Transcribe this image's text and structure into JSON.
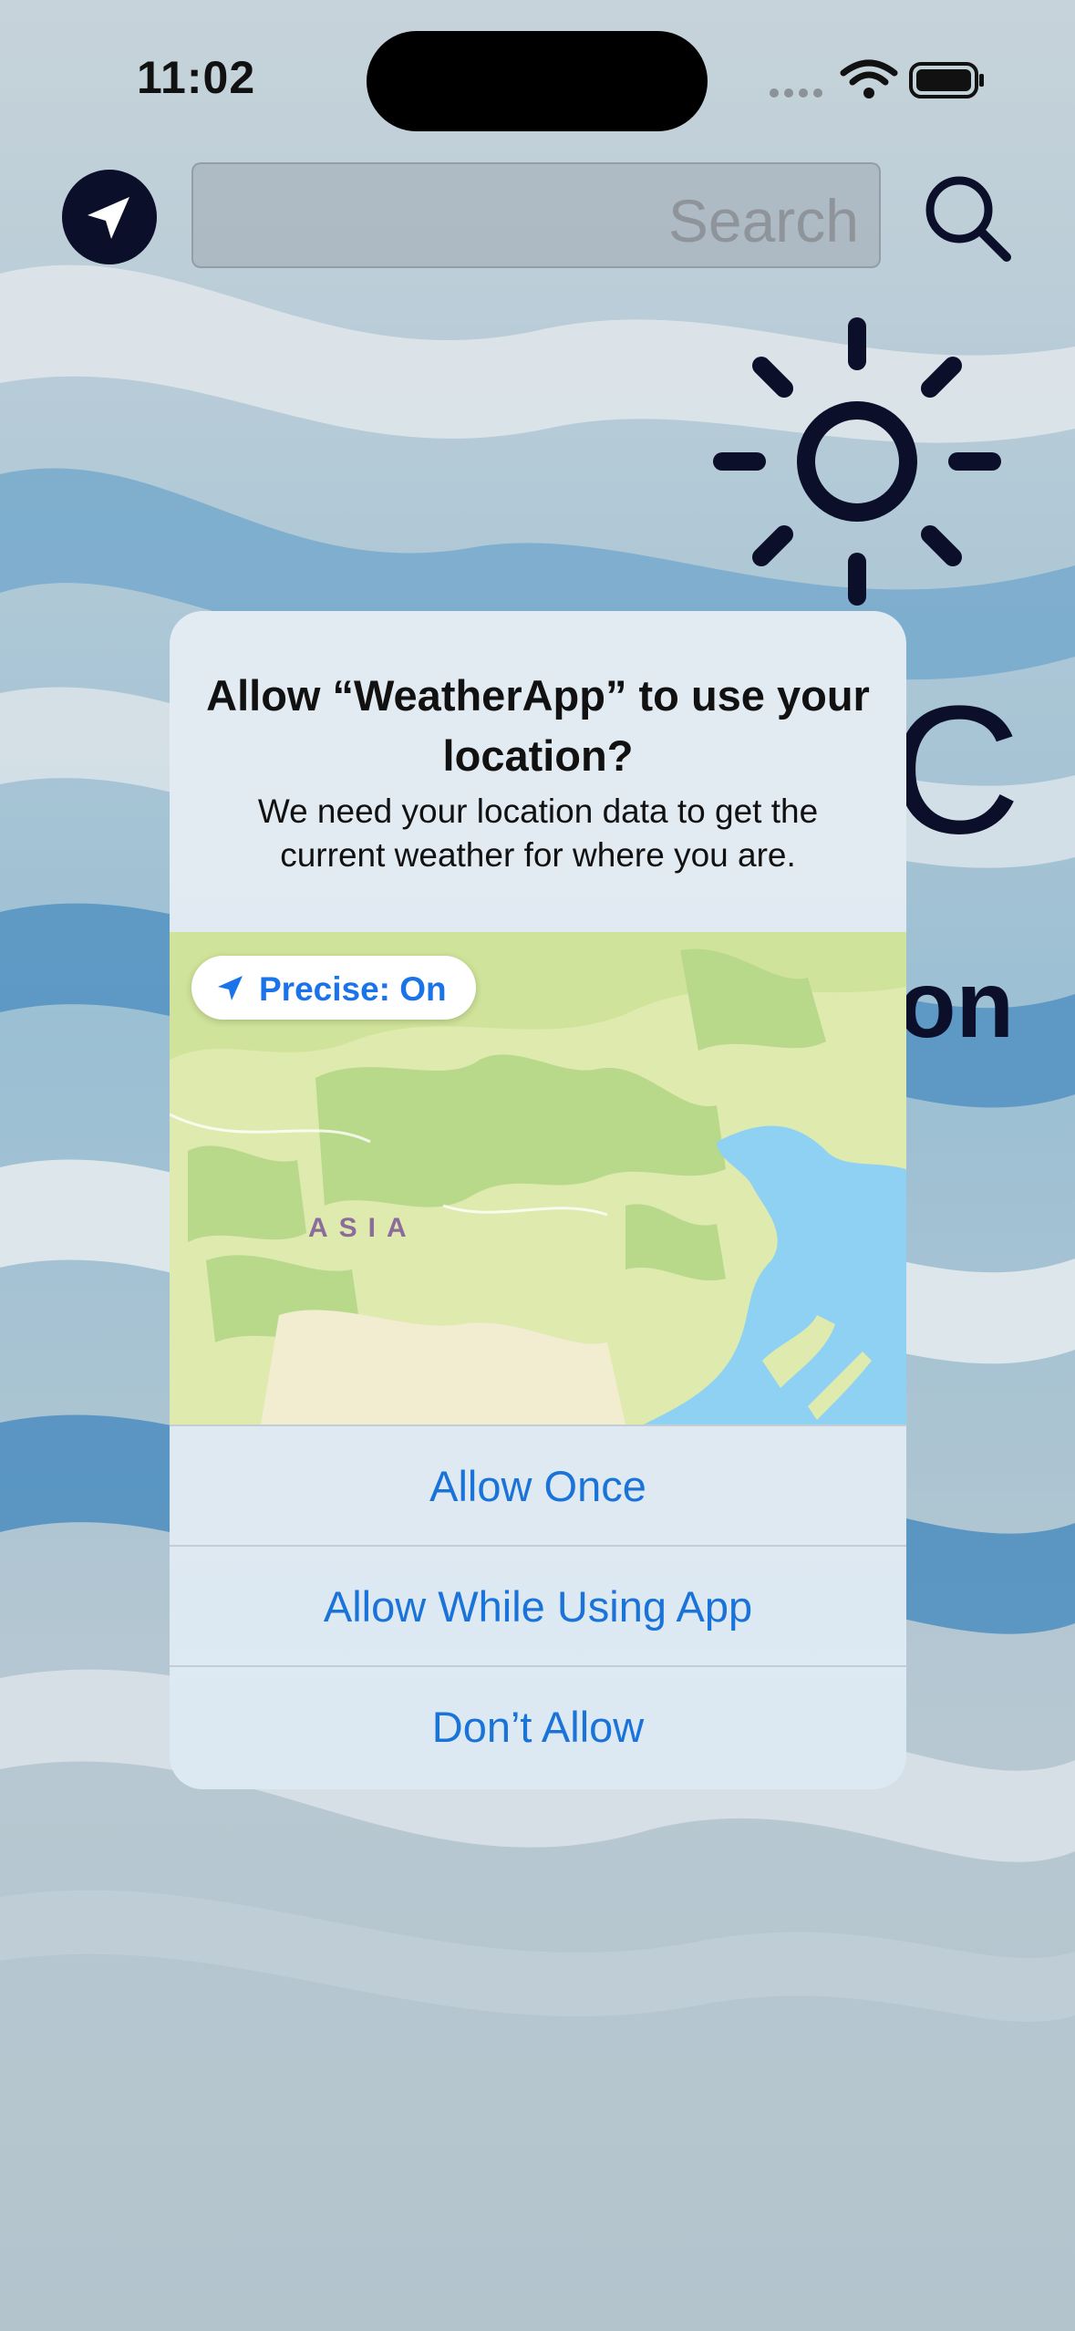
{
  "status_bar": {
    "time": "11:02"
  },
  "search": {
    "placeholder": "Search"
  },
  "weather": {
    "temp_partial": "C",
    "location_partial": "on"
  },
  "alert": {
    "title": "Allow “WeatherApp” to use your location?",
    "message": "We need your location data to get the current weather for where you are.",
    "precise_label": "Precise: On",
    "map_label": "ASIA",
    "buttons": {
      "allow_once": "Allow Once",
      "allow_while_using": "Allow While Using App",
      "dont_allow": "Don’t Allow"
    }
  },
  "colors": {
    "accent": "#1a73d8",
    "dark": "#0b0f2a"
  }
}
